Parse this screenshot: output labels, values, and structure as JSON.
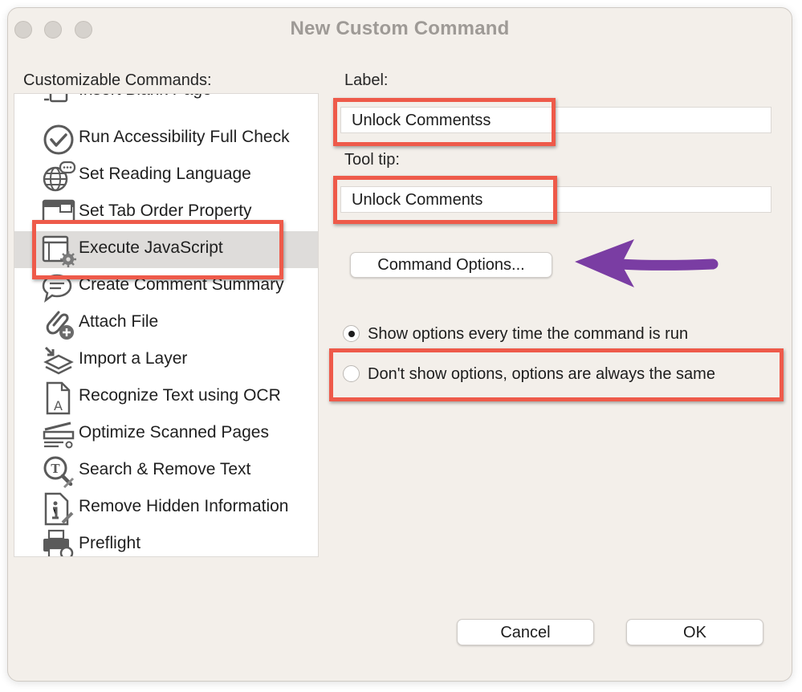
{
  "window": {
    "title": "New Custom Command"
  },
  "commands": {
    "heading": "Customizable Commands:",
    "items": [
      {
        "label": "Insert Blank Page",
        "icon": "blank-page-icon"
      },
      {
        "label": "Run Accessibility Full Check",
        "icon": "checkmark-circle-icon"
      },
      {
        "label": "Set Reading Language",
        "icon": "globe-speech-icon"
      },
      {
        "label": "Set Tab Order Property",
        "icon": "tab-order-icon"
      },
      {
        "label": "Execute JavaScript",
        "icon": "window-gear-icon",
        "selected": true
      },
      {
        "label": "Create Comment Summary",
        "icon": "comment-bubble-icon"
      },
      {
        "label": "Attach File",
        "icon": "paperclip-plus-icon"
      },
      {
        "label": "Import a Layer",
        "icon": "layer-import-icon"
      },
      {
        "label": "Recognize Text using OCR",
        "icon": "ocr-document-icon"
      },
      {
        "label": "Optimize Scanned Pages",
        "icon": "scanner-icon"
      },
      {
        "label": "Search & Remove Text",
        "icon": "magnifier-text-icon"
      },
      {
        "label": "Remove Hidden Information",
        "icon": "info-document-icon"
      },
      {
        "label": "Preflight",
        "icon": "printer-magnifier-icon"
      }
    ]
  },
  "form": {
    "label_heading": "Label:",
    "label_value": "Unlock Commentss",
    "tooltip_heading": "Tool tip:",
    "tooltip_value": "Unlock Comments",
    "command_options_label": "Command Options...",
    "options_mode": {
      "choices": [
        "Show options every time the command is run",
        "Don't show options, options are always the same"
      ],
      "selected": "Show options every time the command is run"
    }
  },
  "footer": {
    "cancel_label": "Cancel",
    "ok_label": "OK"
  },
  "annotations": {
    "highlight_color": "#ee5a4a",
    "arrow_color": "#7a3da3"
  }
}
